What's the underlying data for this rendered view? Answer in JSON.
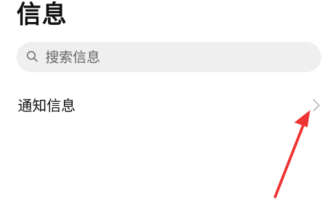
{
  "header": {
    "title": "信息"
  },
  "search": {
    "placeholder": "搜索信息",
    "icon": "search-icon"
  },
  "list": {
    "items": [
      {
        "label": "通知信息",
        "icon": "chevron-right-icon"
      }
    ]
  },
  "annotation": {
    "arrow_color": "#ee3333",
    "target": "chevron-right-icon"
  },
  "colors": {
    "background": "#ffffff",
    "search_background": "#efefef",
    "text": "#111111",
    "chevron": "#b8b8b8",
    "annotation": "#ee3333"
  }
}
